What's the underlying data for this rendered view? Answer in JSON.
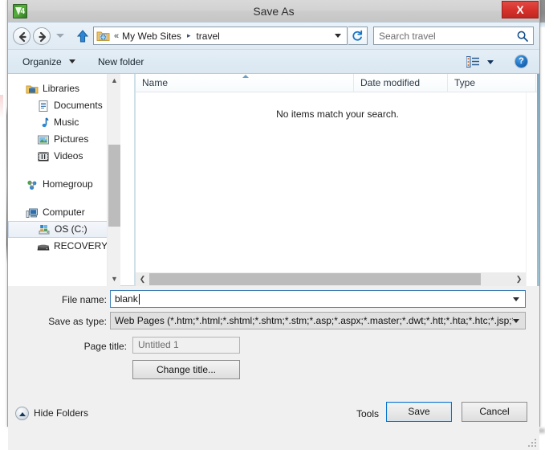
{
  "window": {
    "title": "Save As",
    "app_icon": "expression-web-4-icon",
    "app_icon_badge": "4",
    "close_label": "X"
  },
  "navbar": {
    "back_icon": "arrow-left-icon",
    "forward_icon": "arrow-right-icon",
    "recent_locations_icon": "chevron-down-icon",
    "up_icon": "arrow-up-icon",
    "address": {
      "location_icon": "web-folder-icon",
      "overflow": "«",
      "crumbs": [
        "My Web Sites",
        "travel"
      ],
      "separator": "▸",
      "dropdown_icon": "chevron-down-icon"
    },
    "refresh_icon": "refresh-icon",
    "search": {
      "placeholder": "Search travel",
      "value": "",
      "icon": "search-icon"
    }
  },
  "toolbar": {
    "organize_label": "Organize",
    "new_folder_label": "New folder",
    "view_icon": "view-list-icon",
    "view_caret_icon": "chevron-down-icon",
    "help_icon": "help-circle-icon",
    "help_label": "?"
  },
  "navpane": {
    "scroll_up_icon": "chevron-up-icon",
    "scroll_down_icon": "chevron-down-icon",
    "items": [
      {
        "label": "Libraries",
        "icon": "libraries-icon",
        "level": 1,
        "selected": false
      },
      {
        "label": "Documents",
        "icon": "documents-icon",
        "level": 2,
        "selected": false
      },
      {
        "label": "Music",
        "icon": "music-icon",
        "level": 2,
        "selected": false
      },
      {
        "label": "Pictures",
        "icon": "pictures-icon",
        "level": 2,
        "selected": false
      },
      {
        "label": "Videos",
        "icon": "videos-icon",
        "level": 2,
        "selected": false
      },
      {
        "label": "Homegroup",
        "icon": "homegroup-icon",
        "level": 1,
        "selected": false
      },
      {
        "label": "Computer",
        "icon": "computer-icon",
        "level": 1,
        "selected": false
      },
      {
        "label": "OS (C:)",
        "icon": "os-drive-icon",
        "level": 2,
        "selected": true
      },
      {
        "label": "RECOVERY (D:)",
        "icon": "hard-drive-icon",
        "level": 2,
        "selected": false
      }
    ]
  },
  "filelist": {
    "columns": [
      {
        "label": "Name",
        "sorted": "ascending"
      },
      {
        "label": "Date modified",
        "sorted": ""
      },
      {
        "label": "Type",
        "sorted": ""
      }
    ],
    "rows": [],
    "empty_message": "No items match your search.",
    "hscroll": {
      "left_icon": "chevron-left-icon",
      "right_icon": "chevron-right-icon"
    }
  },
  "form": {
    "filename_label": "File name:",
    "filename_value": "blank",
    "filename_dropdown_icon": "chevron-down-icon",
    "savetype_label": "Save as type:",
    "savetype_value": "Web Pages (*.htm;*.html;*.shtml;*.shtm;*.stm;*.asp;*.aspx;*.master;*.dwt;*.htt;*.hta;*.htc;*.jsp;*.cf",
    "savetype_dropdown_icon": "chevron-down-icon",
    "pagetitle_label": "Page title:",
    "pagetitle_value": "Untitled 1",
    "change_title_label": "Change title..."
  },
  "footer": {
    "hide_folders_label": "Hide Folders",
    "hide_folders_icon": "collapse-circle-icon",
    "tools_label": "Tools",
    "tools_caret_icon": "chevron-down-icon",
    "save_label": "Save",
    "cancel_label": "Cancel",
    "resize_grip_icon": "resize-grip-icon"
  },
  "colors": {
    "accent_blue": "#0a74cd",
    "close_red": "#d8322c",
    "titlebar_gray": "#d2d2d2",
    "navbar_blue": "#e3edf5",
    "dialog_face": "#f0f0f0",
    "selected_row": "#e9eff6",
    "scroll_thumb": "#bcbcbc"
  }
}
